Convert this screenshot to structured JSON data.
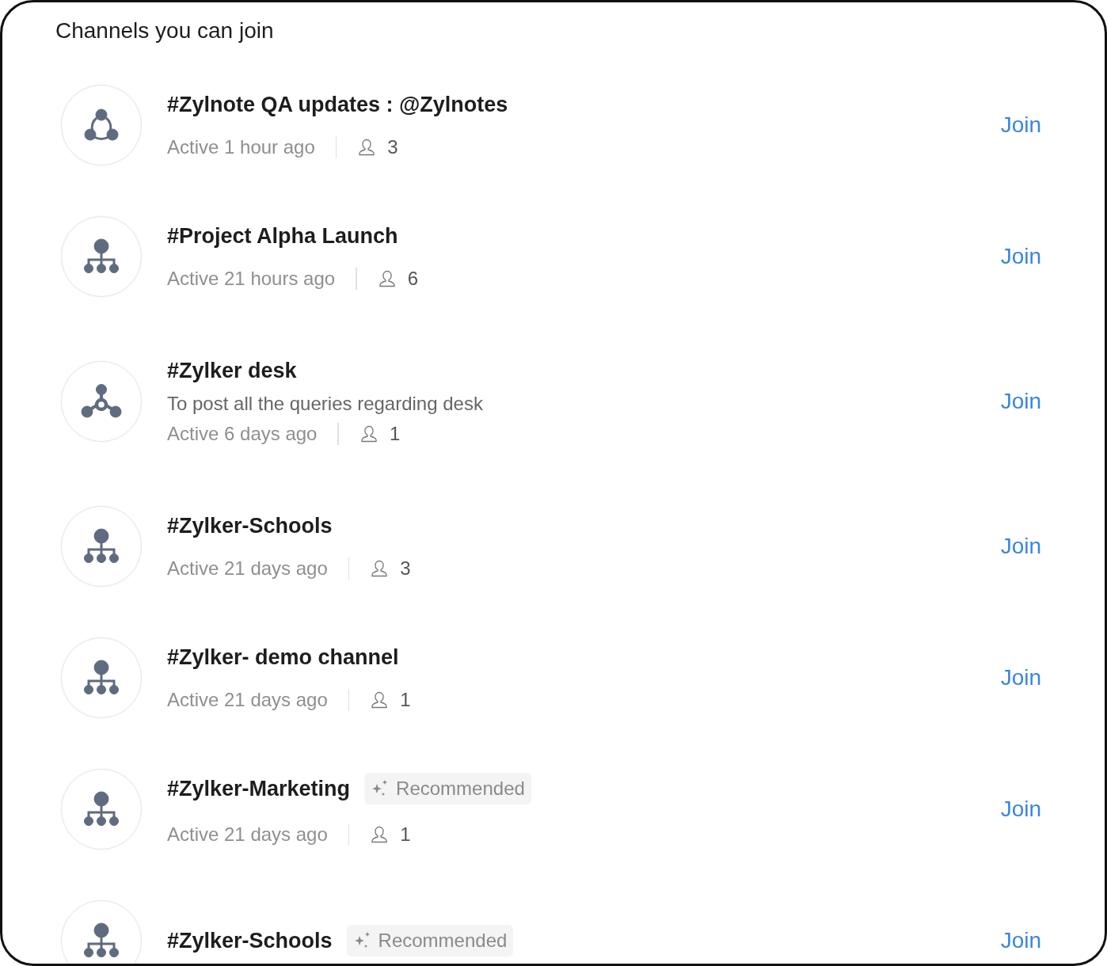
{
  "title": "Channels you can join",
  "channels": [
    {
      "kind": "ring",
      "name": "#Zylnote QA updates : @Zylnotes",
      "activity": "Active 1 hour ago",
      "members": "3",
      "action": "Join"
    },
    {
      "kind": "tree",
      "name": "#Project Alpha Launch",
      "activity": "Active 21 hours ago",
      "members": "6",
      "action": "Join"
    },
    {
      "kind": "hub",
      "name": "#Zylker desk",
      "description": "To post all the queries regarding desk",
      "activity": "Active 6 days ago",
      "members": "1",
      "action": "Join"
    },
    {
      "kind": "tree",
      "name": "#Zylker-Schools",
      "activity": "Active 21 days ago",
      "members": "3",
      "action": "Join"
    },
    {
      "kind": "tree",
      "name": "#Zylker- demo channel",
      "activity": "Active 21 days ago",
      "members": "1",
      "action": "Join"
    },
    {
      "kind": "tree",
      "name": "#Zylker-Marketing",
      "badge": "Recommended",
      "activity": "Active 21 days ago",
      "members": "1",
      "action": "Join"
    },
    {
      "kind": "tree",
      "name": "#Zylker-Schools",
      "badge": "Recommended",
      "action": "Join"
    }
  ]
}
